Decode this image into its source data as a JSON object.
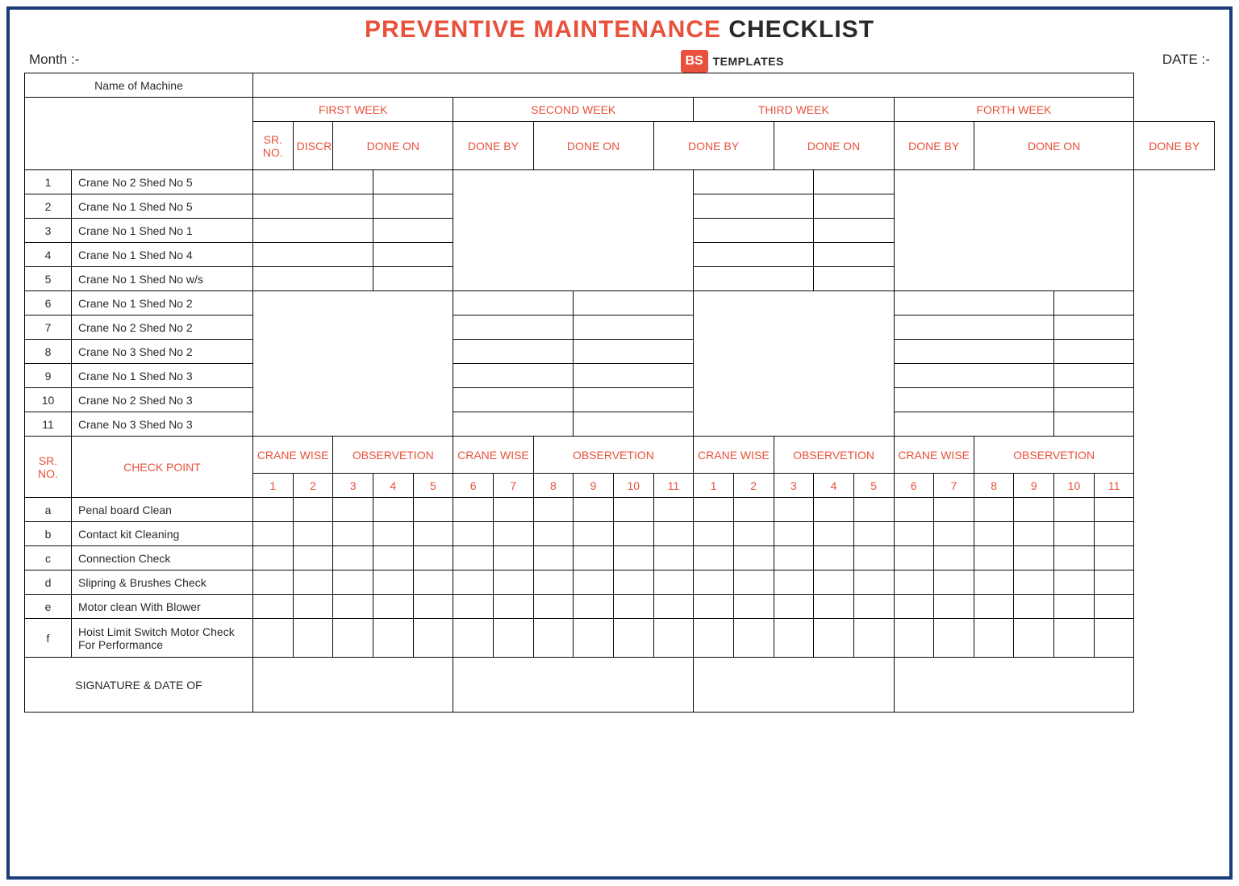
{
  "title": {
    "part1": "PREVENTIVE MAINTENANCE",
    "part2": " CHECKLIST"
  },
  "meta": {
    "month_label": "Month :-",
    "date_label": "DATE :-"
  },
  "logo": {
    "abbrev": "BS",
    "text": "TEMPLATES"
  },
  "headers": {
    "name_of_machine": "Name of Machine",
    "weeks": [
      "FIRST WEEK",
      "SECOND WEEK",
      "THIRD WEEK",
      "FORTH WEEK"
    ],
    "sr_no": "SR. NO.",
    "description": "DISCRIPTION",
    "done_on": "DONE ON",
    "done_by": "DONE BY",
    "check_point": "CHECK POINT",
    "crane_wise": "CRANE WISE",
    "observetion": "OBSERVETION",
    "signature": "SIGNATURE & DATE OF",
    "nums1": [
      "1",
      "2",
      "3",
      "4",
      "5"
    ],
    "nums2": [
      "6",
      "7",
      "8",
      "9",
      "10",
      "11"
    ],
    "nums3": [
      "1",
      "2",
      "3",
      "4",
      "5"
    ],
    "nums4": [
      "6",
      "7",
      "8",
      "9",
      "10",
      "11"
    ]
  },
  "cranes": [
    {
      "sr": "1",
      "desc": "Crane No 2 Shed No 5"
    },
    {
      "sr": "2",
      "desc": "Crane No 1 Shed No 5"
    },
    {
      "sr": "3",
      "desc": "Crane No 1 Shed No 1"
    },
    {
      "sr": "4",
      "desc": "Crane No 1 Shed No 4"
    },
    {
      "sr": "5",
      "desc": "Crane No 1 Shed No w/s"
    },
    {
      "sr": "6",
      "desc": "Crane No 1 Shed No 2"
    },
    {
      "sr": "7",
      "desc": "Crane No 2 Shed No 2"
    },
    {
      "sr": "8",
      "desc": "Crane No 3 Shed No 2"
    },
    {
      "sr": "9",
      "desc": "Crane No 1 Shed No 3"
    },
    {
      "sr": "10",
      "desc": "Crane No 2 Shed No 3"
    },
    {
      "sr": "11",
      "desc": "Crane No 3 Shed No 3"
    }
  ],
  "checks": [
    {
      "sr": "a",
      "desc": "Penal board Clean"
    },
    {
      "sr": "b",
      "desc": "Contact kit Cleaning"
    },
    {
      "sr": "c",
      "desc": "Connection Check"
    },
    {
      "sr": "d",
      "desc": "Slipring & Brushes Check"
    },
    {
      "sr": "e",
      "desc": "Motor clean With Blower"
    },
    {
      "sr": "f",
      "desc": "Hoist Limit Switch Motor Check For Performance"
    }
  ]
}
